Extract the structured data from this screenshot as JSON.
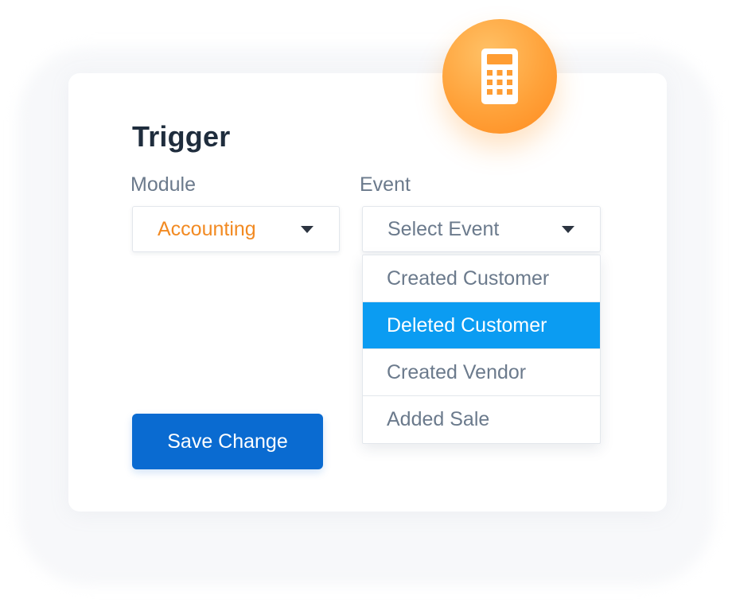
{
  "form": {
    "title": "Trigger",
    "module": {
      "label": "Module",
      "value": "Accounting"
    },
    "event": {
      "label": "Event",
      "placeholder": "Select Event",
      "options": [
        {
          "label": "Created Customer",
          "highlighted": false
        },
        {
          "label": "Deleted Customer",
          "highlighted": true
        },
        {
          "label": "Created Vendor",
          "highlighted": false
        },
        {
          "label": "Added Sale",
          "highlighted": false
        }
      ]
    },
    "save_label": "Save Change"
  },
  "badge": {
    "icon": "calculator-icon"
  },
  "colors": {
    "accent_orange": "#f28a22",
    "primary_blue": "#0a6bd1",
    "highlight_blue": "#0b9cf2",
    "title_text": "#1f2d3d",
    "muted_text": "#6b7a8c"
  }
}
